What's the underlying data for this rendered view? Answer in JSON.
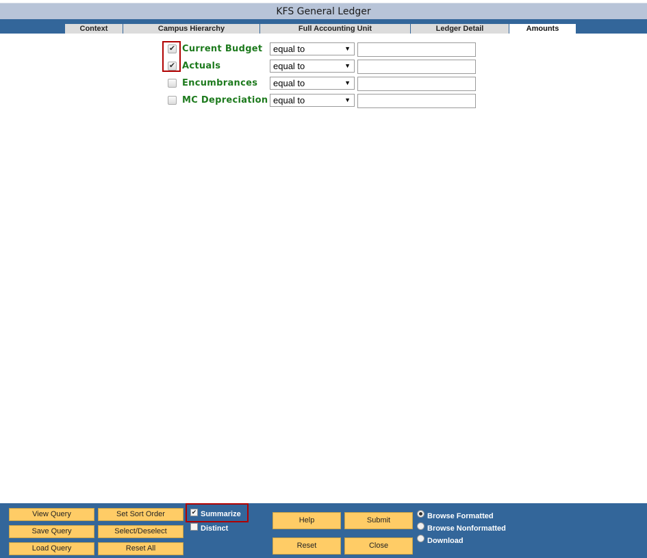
{
  "window": {
    "title": "KFS General Ledger"
  },
  "tabs": [
    {
      "label": "Context"
    },
    {
      "label": "Campus Hierarchy"
    },
    {
      "label": "Full Accounting Unit"
    },
    {
      "label": "Ledger Detail"
    },
    {
      "label": "Amounts",
      "active": true
    }
  ],
  "amounts": [
    {
      "label": "Current Budget",
      "checked": true,
      "operator": "equal to",
      "value": ""
    },
    {
      "label": "Actuals",
      "checked": true,
      "operator": "equal to",
      "value": ""
    },
    {
      "label": "Encumbrances",
      "checked": false,
      "operator": "equal to",
      "value": ""
    },
    {
      "label": "MC Depreciation",
      "checked": false,
      "operator": "equal to",
      "value": ""
    }
  ],
  "buttons": {
    "view_query": "View Query",
    "set_sort_order": "Set Sort Order",
    "save_query": "Save Query",
    "select_deselect": "Select/Deselect",
    "load_query": "Load Query",
    "reset_all": "Reset All",
    "help": "Help",
    "submit": "Submit",
    "reset": "Reset",
    "close": "Close"
  },
  "options": {
    "summarize": {
      "label": "Summarize",
      "checked": true
    },
    "distinct": {
      "label": "Distinct",
      "checked": false
    }
  },
  "output_modes": [
    {
      "label": "Browse Formatted",
      "selected": true
    },
    {
      "label": "Browse Nonformatted",
      "selected": false
    },
    {
      "label": "Download",
      "selected": false
    }
  ],
  "colors": {
    "header_band": "#33669a",
    "title_bg": "#b8c4d8",
    "label_green": "#1d7a1d",
    "button_yellow": "#ffcc66",
    "highlight_red": "#b00000"
  }
}
